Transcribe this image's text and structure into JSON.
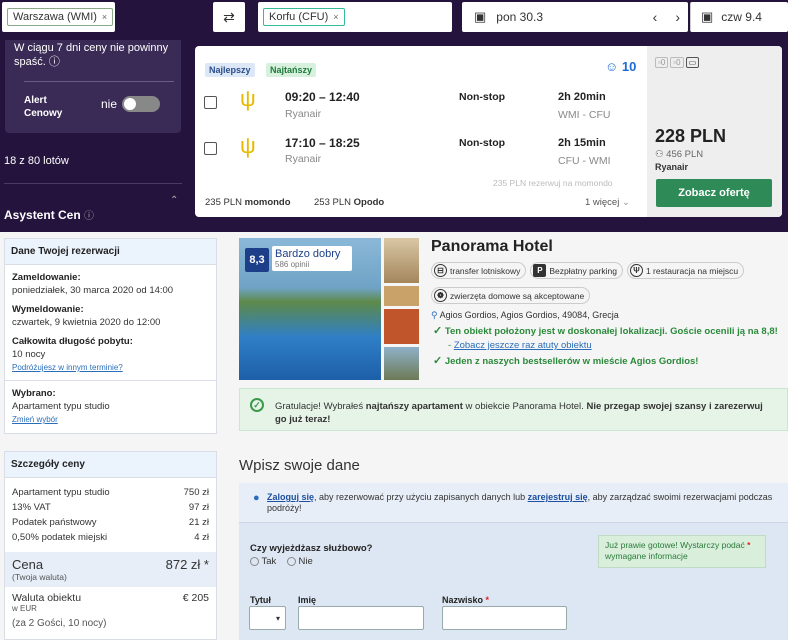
{
  "search": {
    "from": "Warszawa (WMI)",
    "to": "Korfu (CFU)",
    "depart_date": "pon 30.3",
    "return_date": "czw 9.4",
    "swap_icon": "swap-icon",
    "calendar_icon": "calendar-icon",
    "prev": "‹",
    "next": "›"
  },
  "sidebar": {
    "notice": "W ciągu 7 dni ceny nie powinny spaść.",
    "alert_label": "Alert Cenowy",
    "alert_value": "nie",
    "count": "18 z 80 lotów",
    "assistant": "Asystent Cen"
  },
  "flight": {
    "badge_best": "Najlepszy",
    "badge_cheapest": "Najtańszy",
    "score": "10",
    "legs": [
      {
        "times": "09:20 – 12:40",
        "airline": "Ryanair",
        "stops": "Non-stop",
        "duration": "2h 20min",
        "route": "WMI - CFU"
      },
      {
        "times": "17:10 – 18:25",
        "airline": "Ryanair",
        "stops": "Non-stop",
        "duration": "2h 15min",
        "route": "CFU - WMI"
      }
    ],
    "alt1_price": "235 PLN",
    "alt1_site": "momondo",
    "alt2_price": "253 PLN",
    "alt2_site": "Opodo",
    "more": "1 więcej",
    "reserve_note": "235 PLN rezerwuj na momondo",
    "bag_counts": [
      "0",
      "0"
    ],
    "price": "228 PLN",
    "price_per": "456 PLN",
    "price_airline": "Ryanair",
    "cta": "Zobacz ofertę"
  },
  "reservation": {
    "title": "Dane Twojej rezerwacji",
    "checkin_label": "Zameldowanie:",
    "checkin": "poniedziałek, 30 marca 2020 od 14:00",
    "checkout_label": "Wymeldowanie:",
    "checkout": "czwartek, 9 kwietnia 2020 do 12:00",
    "length_label": "Całkowita długość pobytu:",
    "length": "10 nocy",
    "change_dates": "Podróżujesz w innym terminie?",
    "chosen_label": "Wybrano:",
    "chosen": "Apartament typu studio",
    "change_choice": "Zmień wybór"
  },
  "price_details": {
    "title": "Szczegóły ceny",
    "rows": [
      {
        "label": "Apartament typu studio",
        "value": "750 zł"
      },
      {
        "label": "13% VAT",
        "value": "97 zł"
      },
      {
        "label": "Podatek państwowy",
        "value": "21 zł"
      },
      {
        "label": "0,50% podatek miejski",
        "value": "4 zł"
      }
    ],
    "total_label": "Cena",
    "total_sub": "(Twoja waluta)",
    "total": "872 zł *",
    "local_label": "Waluta obiektu",
    "local_sub": "w EUR",
    "local": "€ 205",
    "guests": "(za 2 Gości, 10 nocy)"
  },
  "hotel": {
    "score": "8,3",
    "rating": "Bardzo dobry",
    "reviews": "586 opinii",
    "name": "Panorama Hotel",
    "amenities": [
      "transfer lotniskowy",
      "Bezpłatny parking",
      "1 restauracja na miejscu"
    ],
    "pets": "zwierzęta domowe są akceptowane",
    "address": "Agios Gordios, Agios Gordios, 49084, Grecja",
    "loc": "Ten obiekt położony jest w doskonałej lokalizacji. Goście ocenili ją na 8,8!",
    "loc_link": "Zobacz jeszcze raz atuty obiektu",
    "bestseller": "Jeden z naszych bestsellerów w mieście Agios Gordios!"
  },
  "congrats": {
    "pre": "Gratulacje! Wybrałeś ",
    "bold1": "najtańszy apartament",
    "mid": " w obiekcie Panorama Hotel. ",
    "bold2": "Nie przegap swojej szansy i zarezerwuj go już teraz!"
  },
  "form": {
    "title": "Wpisz swoje dane",
    "login_link": "Zaloguj się",
    "login_mid": ", aby rezerwować przy użyciu zapisanych danych lub ",
    "register_link": "zarejestruj się",
    "login_end": ", aby zarządzać swoimi rezerwacjami podczas podróży!",
    "business_q": "Czy wyjeżdżasz służbowo?",
    "yes": "Tak",
    "no": "Nie",
    "hint": "Już prawie gotowe! Wystarczy podać",
    "hint2": "wymagane informacje",
    "title_label": "Tytuł",
    "first_label": "Imię",
    "last_label": "Nazwisko"
  }
}
